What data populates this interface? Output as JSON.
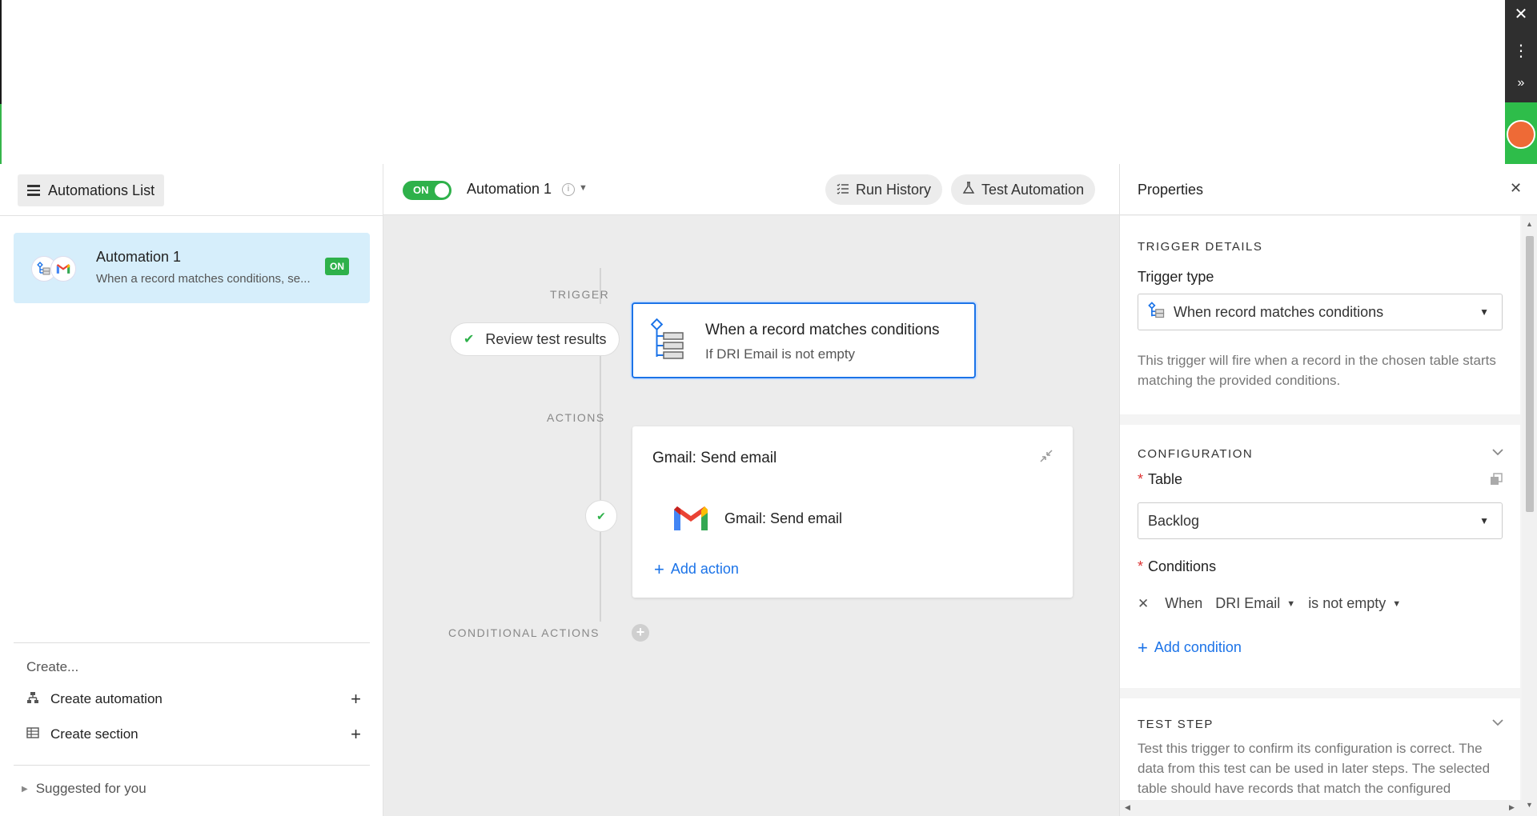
{
  "window": {
    "close_glyph": "✕",
    "menu_glyph": "⋮",
    "expand_glyph": "»"
  },
  "left_panel": {
    "list_button_label": "Automations List",
    "automations": [
      {
        "title": "Automation 1",
        "description": "When a record matches conditions, se...",
        "status_badge": "ON",
        "icons": [
          "trigger-icon",
          "gmail-icon"
        ]
      }
    ],
    "create_label": "Create...",
    "create_items": [
      {
        "label": "Create automation",
        "icon": "flow-icon"
      },
      {
        "label": "Create section",
        "icon": "table-icon"
      }
    ],
    "suggested_label": "Suggested for you"
  },
  "header": {
    "toggle_label": "ON",
    "automation_name": "Automation 1",
    "run_history_label": "Run History",
    "test_automation_label": "Test Automation"
  },
  "flow": {
    "trigger_label": "TRIGGER",
    "actions_label": "ACTIONS",
    "conditional_actions_label": "CONDITIONAL ACTIONS",
    "review_button_label": "Review test results",
    "trigger_card": {
      "title": "When a record matches conditions",
      "subtitle": "If DRI Email is not empty"
    },
    "action_card": {
      "title": "Gmail: Send email",
      "step_label": "Gmail: Send email",
      "add_action_label": "Add action"
    }
  },
  "properties": {
    "title": "Properties",
    "trigger_details": {
      "section_title": "TRIGGER DETAILS",
      "trigger_type_label": "Trigger type",
      "trigger_type_value": "When record matches conditions",
      "help_text": "This trigger will fire when a record in the chosen table starts matching the provided conditions."
    },
    "configuration": {
      "section_title": "CONFIGURATION",
      "table_label": "Table",
      "table_value": "Backlog",
      "conditions_label": "Conditions",
      "condition": {
        "prefix": "When",
        "field": "DRI Email",
        "operator": "is not empty"
      },
      "add_condition_label": "Add condition"
    },
    "test_step": {
      "section_title": "TEST STEP",
      "help_text": "Test this trigger to confirm its configuration is correct. The data from this test can be used in later steps. The selected table should have records that match the configured conditions."
    }
  },
  "colors": {
    "accent_blue": "#1b73e8",
    "on_green": "#2eb14a",
    "selected_card_bg": "#d6eefb"
  }
}
